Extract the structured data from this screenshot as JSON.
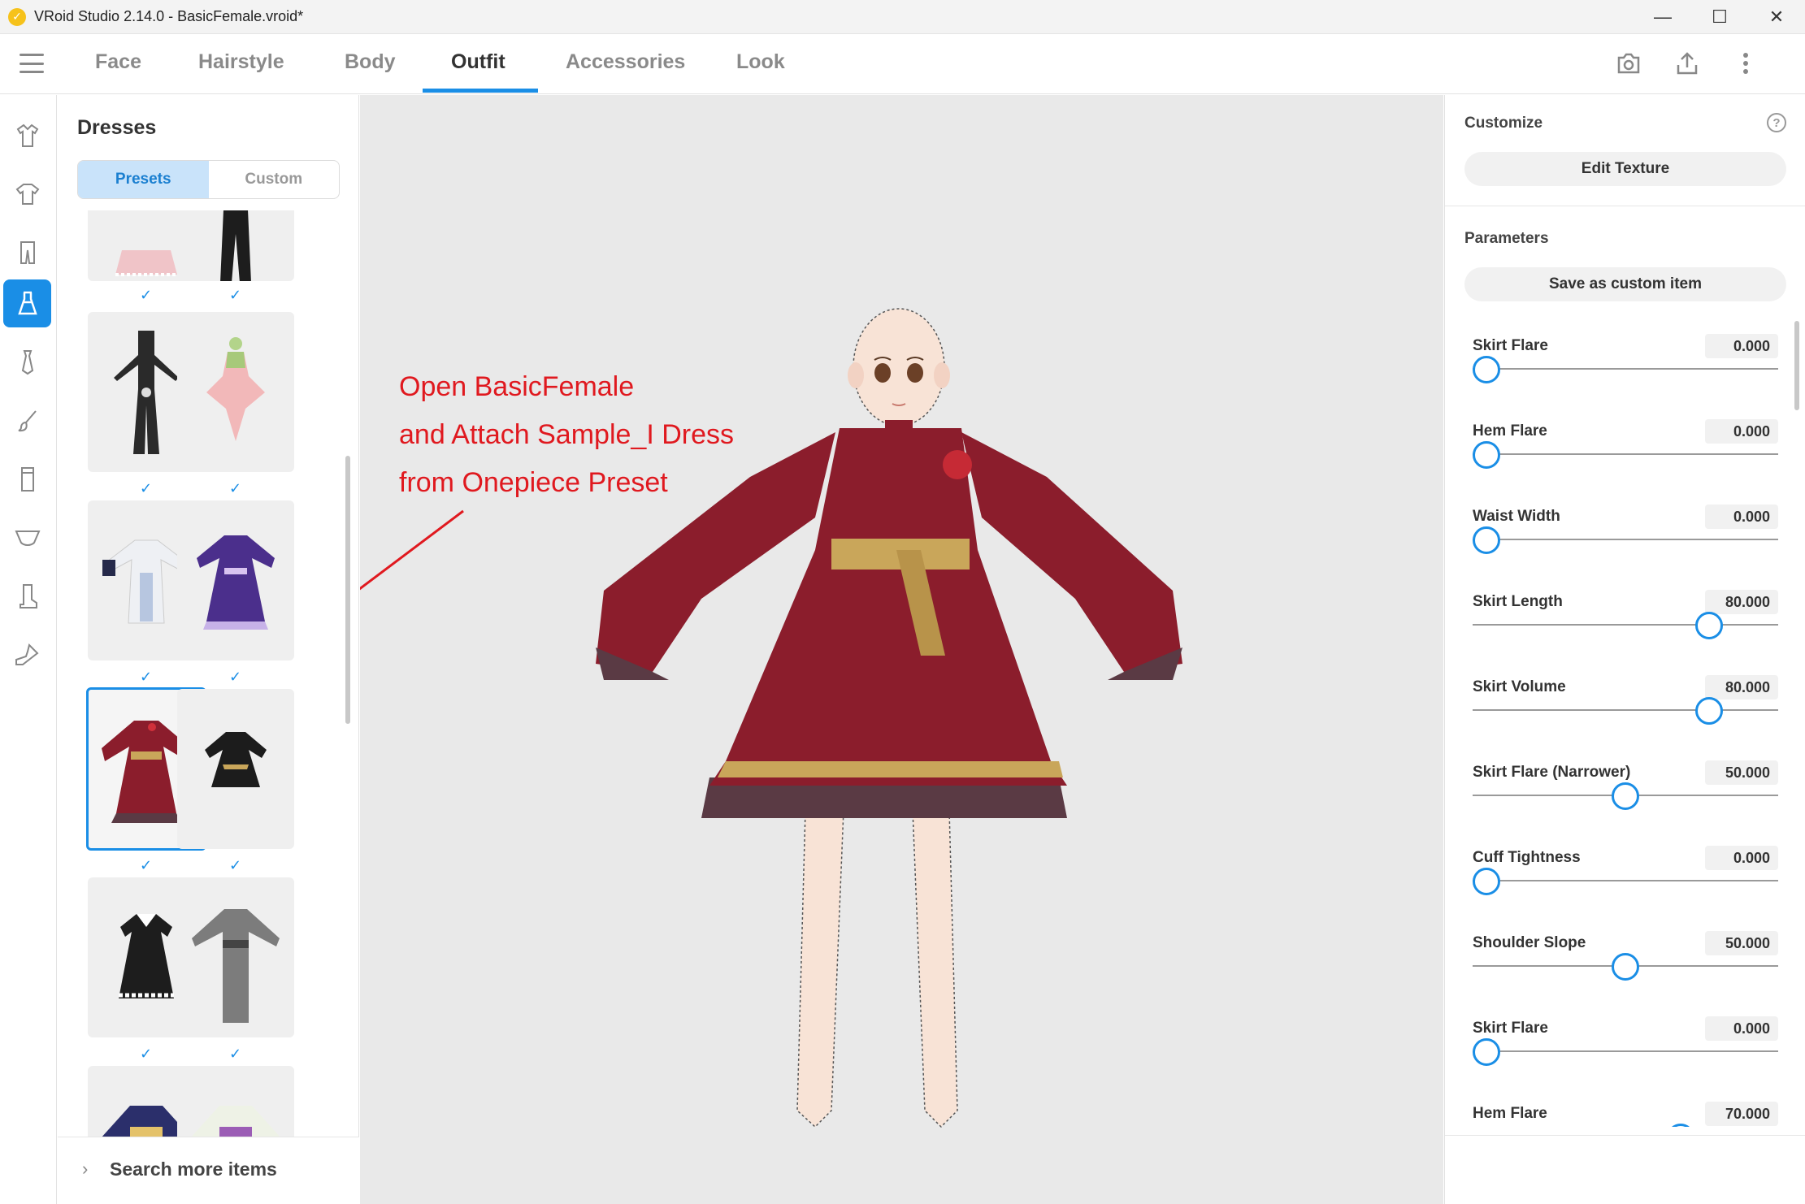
{
  "window": {
    "title": "VRoid Studio 2.14.0 - BasicFemale.vroid*",
    "minimize_glyph": "—",
    "maximize_glyph": "☐",
    "close_glyph": "✕"
  },
  "nav": {
    "tabs": [
      {
        "label": "Face"
      },
      {
        "label": "Hairstyle"
      },
      {
        "label": "Body"
      },
      {
        "label": "Outfit"
      },
      {
        "label": "Accessories"
      },
      {
        "label": "Look"
      }
    ],
    "active_tab": "Outfit",
    "actions": [
      "camera-icon",
      "export-icon",
      "more-vertical-icon"
    ]
  },
  "rail": {
    "items": [
      "coat-icon",
      "shirt-icon",
      "pants-icon",
      "dress-icon",
      "tie-icon",
      "brush-icon",
      "socks-icon",
      "bra-icon",
      "boot-icon",
      "shoe-icon"
    ],
    "active_item": "dress-icon"
  },
  "panel": {
    "title": "Dresses",
    "segments": [
      "Presets",
      "Custom"
    ],
    "active_segment": "Presets",
    "check_glyph": "✓",
    "search_more": "Search more items",
    "chevron": "›"
  },
  "viewport": {
    "annotation_lines": [
      "Open BasicFemale",
      "and Attach Sample_I Dress",
      "from Onepiece Preset"
    ],
    "annotation_color": "#e0191f"
  },
  "right": {
    "customize_label": "Customize",
    "help_glyph": "?",
    "edit_texture_label": "Edit Texture",
    "parameters_label": "Parameters",
    "save_custom_label": "Save as custom item",
    "params": [
      {
        "name": "Skirt Flare",
        "value": "0.000",
        "fraction": 0.0
      },
      {
        "name": "Hem Flare",
        "value": "0.000",
        "fraction": 0.0
      },
      {
        "name": "Waist Width",
        "value": "0.000",
        "fraction": 0.0
      },
      {
        "name": "Skirt Length",
        "value": "80.000",
        "fraction": 0.8
      },
      {
        "name": "Skirt Volume",
        "value": "80.000",
        "fraction": 0.8
      },
      {
        "name": "Skirt Flare (Narrower)",
        "value": "50.000",
        "fraction": 0.5
      },
      {
        "name": "Cuff Tightness",
        "value": "0.000",
        "fraction": 0.0
      },
      {
        "name": "Shoulder Slope",
        "value": "50.000",
        "fraction": 0.5
      },
      {
        "name": "Skirt Flare",
        "value": "0.000",
        "fraction": 0.0
      },
      {
        "name": "Hem Flare",
        "value": "70.000",
        "fraction": 0.7
      }
    ]
  },
  "colors": {
    "accent": "#1a8ee6",
    "dress_red": "#8b1d2c",
    "dress_gold": "#c9a65a",
    "skin": "#f8e3d6"
  }
}
